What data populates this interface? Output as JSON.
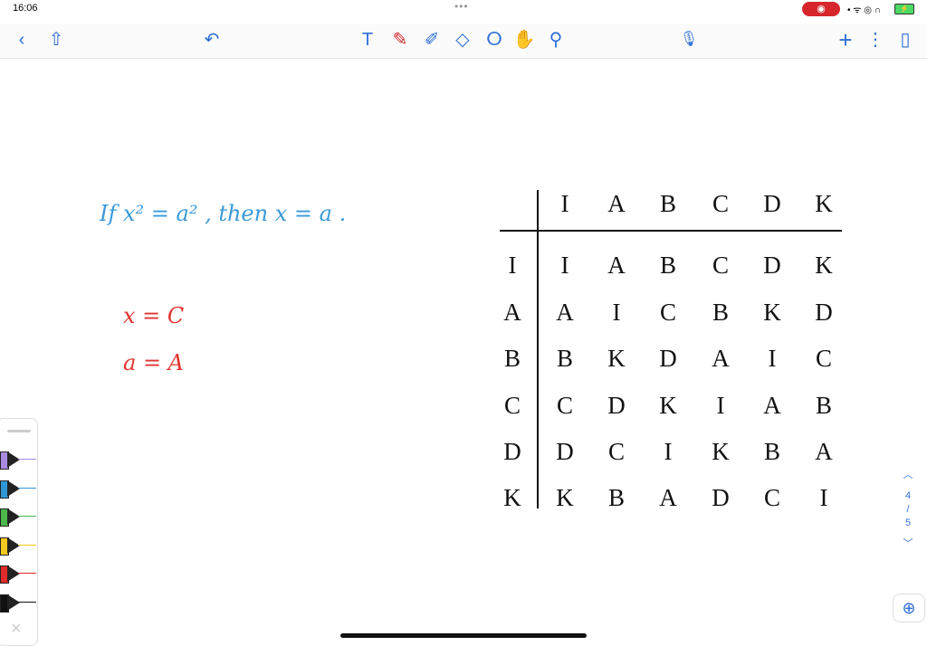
{
  "status": {
    "time": "16:06",
    "more": "•••",
    "record_icon": "record-icon",
    "battery_icon": "battery-charging-icon",
    "system_icons": "• ᯤ ◎ ∩"
  },
  "toolbar": {
    "back": "‹",
    "share": "⇧",
    "undo": "↶",
    "text": "T",
    "pen": "✎",
    "highlighter": "✐",
    "eraser": "◇",
    "lasso": "ⵔ",
    "hand": "✋",
    "laser": "⚲",
    "mic": "🎙",
    "add": "+",
    "more": "⋮",
    "pages": "▯"
  },
  "notes": {
    "sentence": "If  x² = a² ,  then  x = a .",
    "eq1": "x = C",
    "eq2": "a = A",
    "colors": {
      "blue": "#3a9ad9",
      "red": "#e0342f"
    }
  },
  "table": {
    "col_headers": [
      "I",
      "A",
      "B",
      "C",
      "D",
      "K"
    ],
    "rows": [
      {
        "label": "I",
        "cells": [
          "I",
          "A",
          "B",
          "C",
          "D",
          "K"
        ]
      },
      {
        "label": "A",
        "cells": [
          "A",
          "I",
          "C",
          "B",
          "K",
          "D"
        ]
      },
      {
        "label": "B",
        "cells": [
          "B",
          "K",
          "D",
          "A",
          "I",
          "C"
        ]
      },
      {
        "label": "C",
        "cells": [
          "C",
          "D",
          "K",
          "I",
          "A",
          "B"
        ]
      },
      {
        "label": "D",
        "cells": [
          "D",
          "C",
          "I",
          "K",
          "B",
          "A"
        ]
      },
      {
        "label": "K",
        "cells": [
          "K",
          "B",
          "A",
          "D",
          "C",
          "I"
        ]
      }
    ]
  },
  "pens": [
    {
      "color": "#a98be0"
    },
    {
      "color": "#2f97d6"
    },
    {
      "color": "#4cb84a"
    },
    {
      "color": "#f2c81e"
    },
    {
      "color": "#e02a2a"
    },
    {
      "color": "#111111"
    }
  ],
  "pen_panel": {
    "close": "×"
  },
  "page_nav": {
    "up": "︿",
    "current": "4",
    "sep": "/",
    "total": "5",
    "down": "﹀"
  },
  "zoom": "⊕"
}
